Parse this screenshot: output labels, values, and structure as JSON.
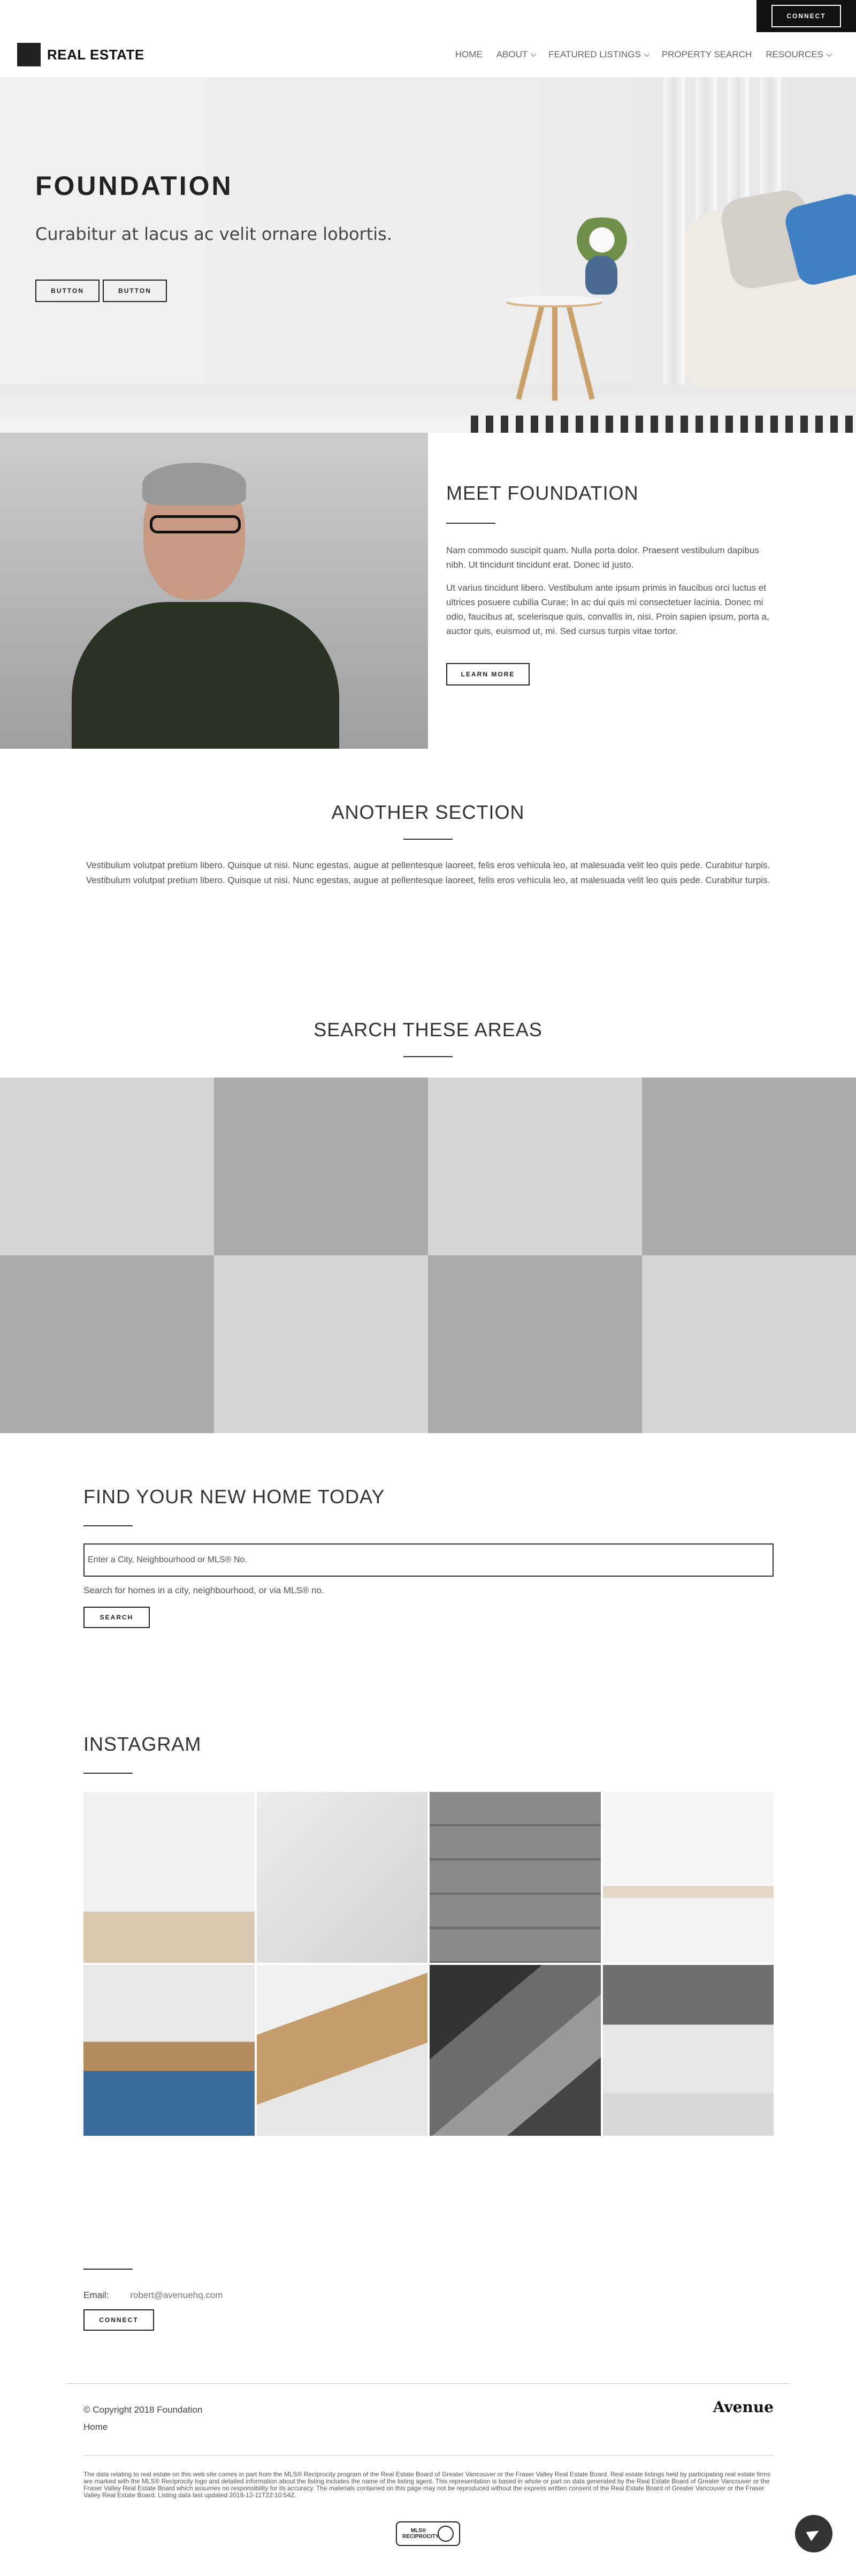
{
  "topbar": {
    "connect_label": "CONNECT"
  },
  "header": {
    "logo_text": "REAL ESTATE",
    "nav": [
      {
        "label": "HOME",
        "has_dropdown": false
      },
      {
        "label": "ABOUT",
        "has_dropdown": true
      },
      {
        "label": "FEATURED LISTINGS",
        "has_dropdown": true
      },
      {
        "label": "PROPERTY SEARCH",
        "has_dropdown": false
      },
      {
        "label": "RESOURCES",
        "has_dropdown": true
      }
    ]
  },
  "hero": {
    "title": "FOUNDATION",
    "subtitle": "Curabitur at lacus ac velit ornare lobortis.",
    "buttons": [
      "BUTTON",
      "BUTTON"
    ]
  },
  "meet": {
    "title": "MEET FOUNDATION",
    "p1": "Nam commodo suscipit quam. Nulla porta dolor. Praesent vestibulum dapibus nibh. Ut tincidunt tincidunt erat. Donec id justo.",
    "p2": "Ut varius tincidunt libero. Vestibulum ante ipsum primis in faucibus orci luctus et ultrices posuere cubilia Curae; In ac dui quis mi consectetuer lacinia. Donec mi odio, faucibus at, scelerisque quis, convallis in, nisi. Proin sapien ipsum, porta a, auctor quis, euismod ut, mi. Sed cursus turpis vitae tortor.",
    "button": "LEARN MORE"
  },
  "another": {
    "title": "ANOTHER SECTION",
    "text": "Vestibulum volutpat pretium libero. Quisque ut nisi. Nunc egestas, augue at pellentesque laoreet, felis eros vehicula leo, at malesuada velit leo quis pede. Curabitur turpis. Vestibulum volutpat pretium libero. Quisque ut nisi. Nunc egestas, augue at pellentesque laoreet, felis eros vehicula leo, at malesuada velit leo quis pede. Curabitur turpis."
  },
  "areas": {
    "title": "SEARCH THESE AREAS",
    "tiles": [
      "light",
      "dark",
      "light",
      "dark",
      "dark",
      "light",
      "dark",
      "light"
    ]
  },
  "find": {
    "title": "FIND YOUR NEW HOME TODAY",
    "placeholder": "Enter a City, Neighbourhood or MLS® No.",
    "hint": "Search for homes in a city, neighbourhood, or via MLS® no.",
    "button": "SEARCH"
  },
  "instagram": {
    "title": "INSTAGRAM"
  },
  "contact": {
    "email_label": "Email:",
    "email_value": "robert@avenuehq.com",
    "button": "CONNECT"
  },
  "footer": {
    "copyright": "© Copyright 2018 Foundation",
    "home_link": "Home",
    "brand": "Avenue",
    "disclaimer": "The data relating to real estate on this web site comes in part from the MLS® Reciprocity program of the Real Estate Board of Greater Vancouver or the Fraser Valley Real Estate Board. Real estate listings held by participating real estate firms are marked with the MLS® Reciprocity logo and detailed information about the listing includes the name of the listing agent. This representation is based in whole or part on data generated by the Real Estate Board of Greater Vancouver or the Fraser Valley Real Estate Board which assumes no responsibility for its accuracy. The materials contained on this page may not be reproduced without the express written consent of the Real Estate Board of Greater Vancouver or the Fraser Valley Real Estate Board. Listing data last updated 2018-12-11T22:10:54Z.",
    "mls_badge": "MLS® RECIPROCITY"
  }
}
